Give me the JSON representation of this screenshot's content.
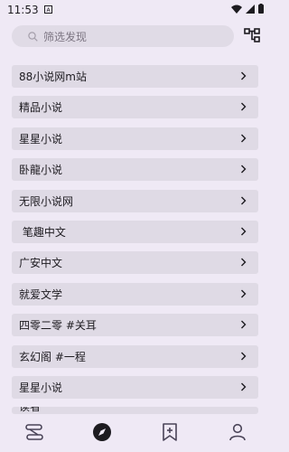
{
  "status_bar": {
    "time": "11:53",
    "notification_icon": "a-square-icon",
    "wifi_icon": "wifi-icon",
    "signal_icon": "signal-icon",
    "battery_icon": "battery-icon"
  },
  "search": {
    "placeholder": "筛选发现",
    "icon": "search-icon"
  },
  "filter_button": {
    "icon": "group-tree-icon"
  },
  "sources": [
    {
      "label": "88小说网m站"
    },
    {
      "label": "精品小说"
    },
    {
      "label": "星星小说"
    },
    {
      "label": "卧龍小说"
    },
    {
      "label": "无限小说网"
    },
    {
      "label": " 笔趣中文"
    },
    {
      "label": "广安中文"
    },
    {
      "label": "就爱文学"
    },
    {
      "label": "四零二零 #关耳"
    },
    {
      "label": "玄幻阁 #一程"
    },
    {
      "label": "星星小说"
    },
    {
      "label": "读者"
    }
  ],
  "bottom_nav": {
    "items": [
      {
        "icon": "bookshelf-icon",
        "active": false
      },
      {
        "icon": "compass-icon",
        "active": true
      },
      {
        "icon": "rss-bookmark-icon",
        "active": false
      },
      {
        "icon": "person-icon",
        "active": false
      }
    ]
  }
}
